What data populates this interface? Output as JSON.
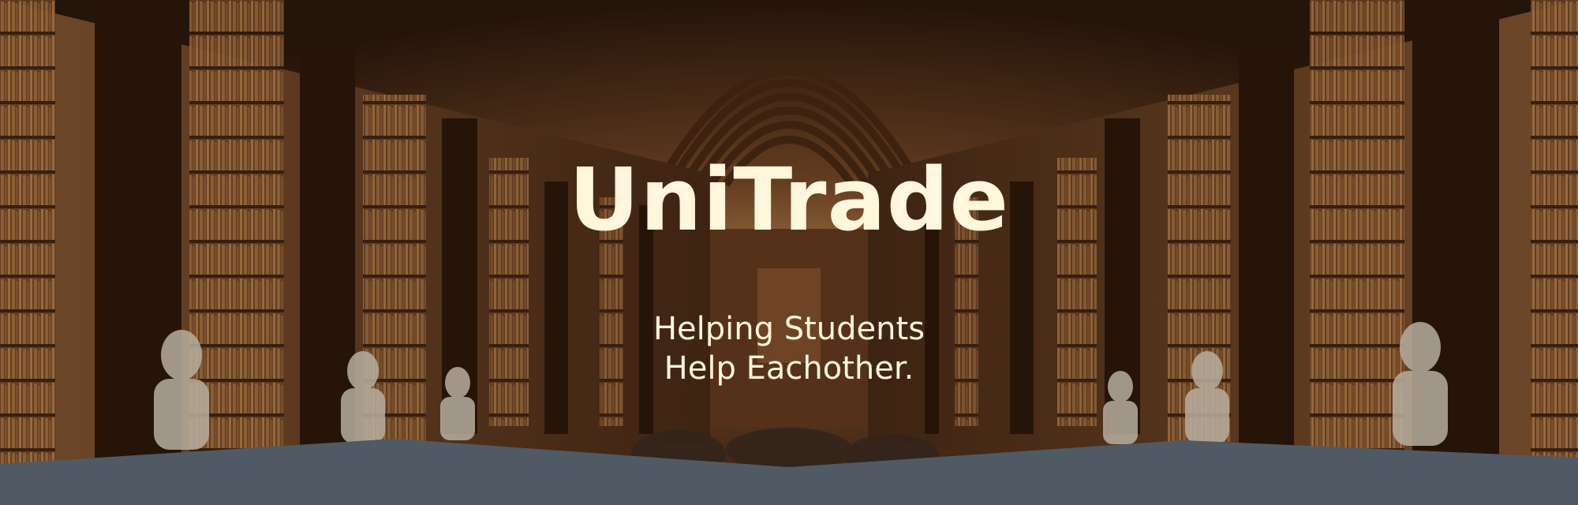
{
  "hero": {
    "title": "UniTrade",
    "tagline_line1": "Helping Students",
    "tagline_line2": "Help Eachother."
  },
  "colors": {
    "title": "#fff6dc",
    "tagline": "#fff6dc",
    "footer_band": "#4f5a64"
  }
}
